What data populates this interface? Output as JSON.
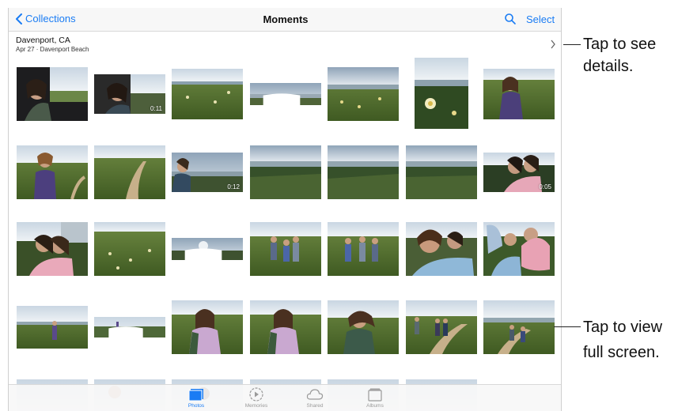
{
  "navbar": {
    "back_label": "Collections",
    "title": "Moments",
    "select_label": "Select"
  },
  "moment": {
    "location": "Davenport, CA",
    "subtitle": "Apr 27 · Davenport Beach"
  },
  "videos": {
    "v1": "0:11",
    "v2": "0:12",
    "v3": "0:05"
  },
  "tabs": [
    {
      "label": "Photos",
      "icon": "photos-icon",
      "active": true
    },
    {
      "label": "Memories",
      "icon": "memories-icon",
      "active": false
    },
    {
      "label": "Shared",
      "icon": "shared-icon",
      "active": false
    },
    {
      "label": "Albums",
      "icon": "albums-icon",
      "active": false
    }
  ],
  "callouts": {
    "details_line1": "Tap to see",
    "details_line2": "details.",
    "fullscreen_line1": "Tap to view",
    "fullscreen_line2": "full screen."
  },
  "colors": {
    "accent": "#1a7cf4"
  }
}
